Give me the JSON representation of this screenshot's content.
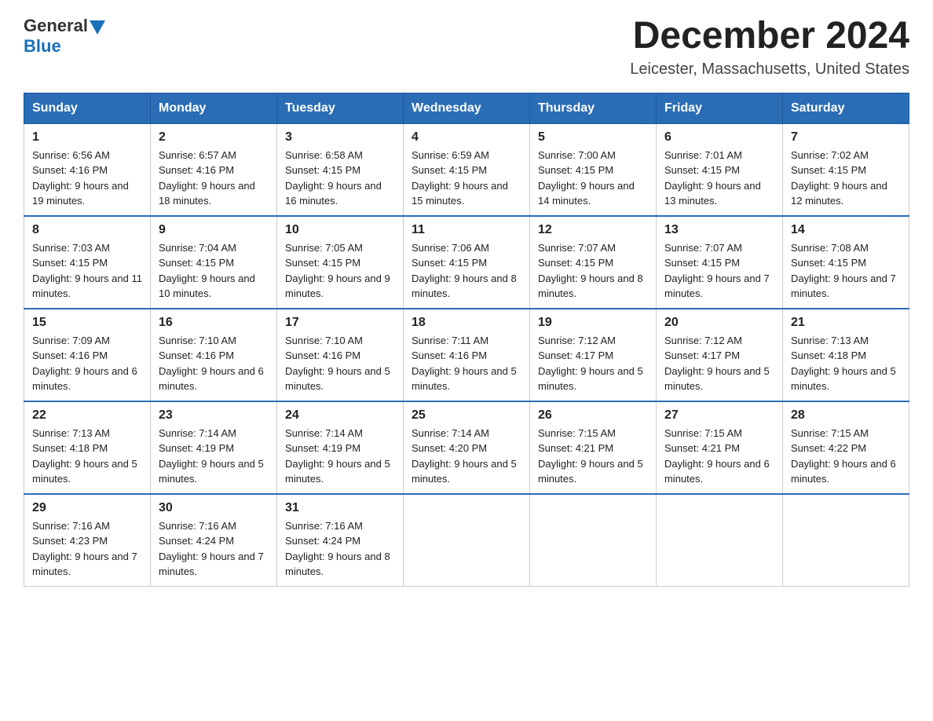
{
  "header": {
    "logo_general": "General",
    "logo_blue": "Blue",
    "month_title": "December 2024",
    "location": "Leicester, Massachusetts, United States"
  },
  "weekdays": [
    "Sunday",
    "Monday",
    "Tuesday",
    "Wednesday",
    "Thursday",
    "Friday",
    "Saturday"
  ],
  "weeks": [
    [
      {
        "day": "1",
        "sunrise": "6:56 AM",
        "sunset": "4:16 PM",
        "daylight": "9 hours and 19 minutes."
      },
      {
        "day": "2",
        "sunrise": "6:57 AM",
        "sunset": "4:16 PM",
        "daylight": "9 hours and 18 minutes."
      },
      {
        "day": "3",
        "sunrise": "6:58 AM",
        "sunset": "4:15 PM",
        "daylight": "9 hours and 16 minutes."
      },
      {
        "day": "4",
        "sunrise": "6:59 AM",
        "sunset": "4:15 PM",
        "daylight": "9 hours and 15 minutes."
      },
      {
        "day": "5",
        "sunrise": "7:00 AM",
        "sunset": "4:15 PM",
        "daylight": "9 hours and 14 minutes."
      },
      {
        "day": "6",
        "sunrise": "7:01 AM",
        "sunset": "4:15 PM",
        "daylight": "9 hours and 13 minutes."
      },
      {
        "day": "7",
        "sunrise": "7:02 AM",
        "sunset": "4:15 PM",
        "daylight": "9 hours and 12 minutes."
      }
    ],
    [
      {
        "day": "8",
        "sunrise": "7:03 AM",
        "sunset": "4:15 PM",
        "daylight": "9 hours and 11 minutes."
      },
      {
        "day": "9",
        "sunrise": "7:04 AM",
        "sunset": "4:15 PM",
        "daylight": "9 hours and 10 minutes."
      },
      {
        "day": "10",
        "sunrise": "7:05 AM",
        "sunset": "4:15 PM",
        "daylight": "9 hours and 9 minutes."
      },
      {
        "day": "11",
        "sunrise": "7:06 AM",
        "sunset": "4:15 PM",
        "daylight": "9 hours and 8 minutes."
      },
      {
        "day": "12",
        "sunrise": "7:07 AM",
        "sunset": "4:15 PM",
        "daylight": "9 hours and 8 minutes."
      },
      {
        "day": "13",
        "sunrise": "7:07 AM",
        "sunset": "4:15 PM",
        "daylight": "9 hours and 7 minutes."
      },
      {
        "day": "14",
        "sunrise": "7:08 AM",
        "sunset": "4:15 PM",
        "daylight": "9 hours and 7 minutes."
      }
    ],
    [
      {
        "day": "15",
        "sunrise": "7:09 AM",
        "sunset": "4:16 PM",
        "daylight": "9 hours and 6 minutes."
      },
      {
        "day": "16",
        "sunrise": "7:10 AM",
        "sunset": "4:16 PM",
        "daylight": "9 hours and 6 minutes."
      },
      {
        "day": "17",
        "sunrise": "7:10 AM",
        "sunset": "4:16 PM",
        "daylight": "9 hours and 5 minutes."
      },
      {
        "day": "18",
        "sunrise": "7:11 AM",
        "sunset": "4:16 PM",
        "daylight": "9 hours and 5 minutes."
      },
      {
        "day": "19",
        "sunrise": "7:12 AM",
        "sunset": "4:17 PM",
        "daylight": "9 hours and 5 minutes."
      },
      {
        "day": "20",
        "sunrise": "7:12 AM",
        "sunset": "4:17 PM",
        "daylight": "9 hours and 5 minutes."
      },
      {
        "day": "21",
        "sunrise": "7:13 AM",
        "sunset": "4:18 PM",
        "daylight": "9 hours and 5 minutes."
      }
    ],
    [
      {
        "day": "22",
        "sunrise": "7:13 AM",
        "sunset": "4:18 PM",
        "daylight": "9 hours and 5 minutes."
      },
      {
        "day": "23",
        "sunrise": "7:14 AM",
        "sunset": "4:19 PM",
        "daylight": "9 hours and 5 minutes."
      },
      {
        "day": "24",
        "sunrise": "7:14 AM",
        "sunset": "4:19 PM",
        "daylight": "9 hours and 5 minutes."
      },
      {
        "day": "25",
        "sunrise": "7:14 AM",
        "sunset": "4:20 PM",
        "daylight": "9 hours and 5 minutes."
      },
      {
        "day": "26",
        "sunrise": "7:15 AM",
        "sunset": "4:21 PM",
        "daylight": "9 hours and 5 minutes."
      },
      {
        "day": "27",
        "sunrise": "7:15 AM",
        "sunset": "4:21 PM",
        "daylight": "9 hours and 6 minutes."
      },
      {
        "day": "28",
        "sunrise": "7:15 AM",
        "sunset": "4:22 PM",
        "daylight": "9 hours and 6 minutes."
      }
    ],
    [
      {
        "day": "29",
        "sunrise": "7:16 AM",
        "sunset": "4:23 PM",
        "daylight": "9 hours and 7 minutes."
      },
      {
        "day": "30",
        "sunrise": "7:16 AM",
        "sunset": "4:24 PM",
        "daylight": "9 hours and 7 minutes."
      },
      {
        "day": "31",
        "sunrise": "7:16 AM",
        "sunset": "4:24 PM",
        "daylight": "9 hours and 8 minutes."
      },
      null,
      null,
      null,
      null
    ]
  ]
}
